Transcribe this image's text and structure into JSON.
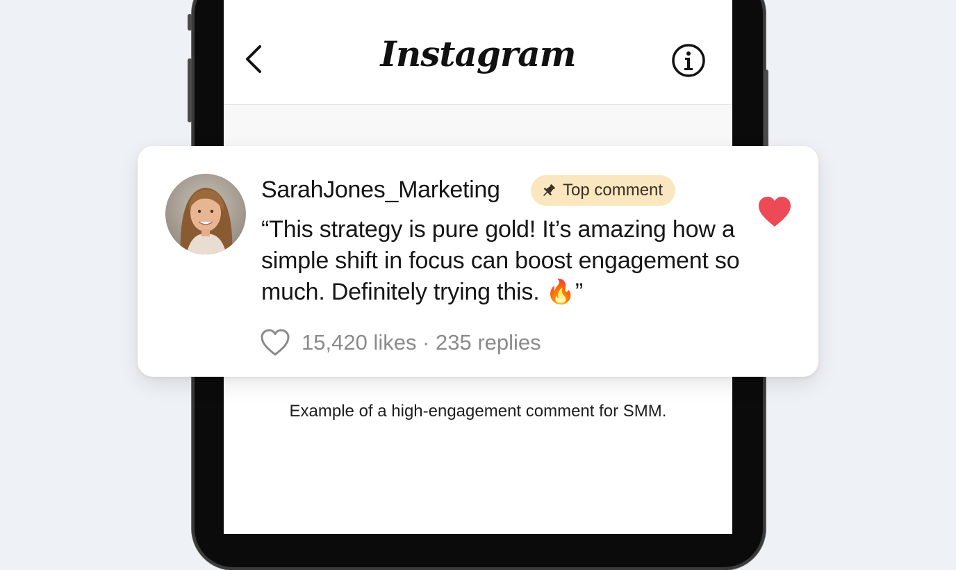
{
  "app": {
    "brand": "Instagram",
    "back_icon": "chevron-left-icon",
    "info_icon": "info-circle-icon"
  },
  "comment": {
    "username": "SarahJones_Marketing",
    "badge_label": "Top comment",
    "badge_icon": "pin-icon",
    "text": "“This strategy is pure gold! It’s amazing how a simple shift in focus can boost engagement so much. Definitely trying this. 🔥”",
    "liked": true,
    "stats": "15,420 likes · 235 replies",
    "like_icon": "heart-outline-icon"
  },
  "caption": "Example of a high-engagement comment for SMM.",
  "colors": {
    "background": "#eef1f5",
    "badge": "#fbe7bf",
    "heart": "#ed4956",
    "muted_text": "#8a8a8a"
  }
}
